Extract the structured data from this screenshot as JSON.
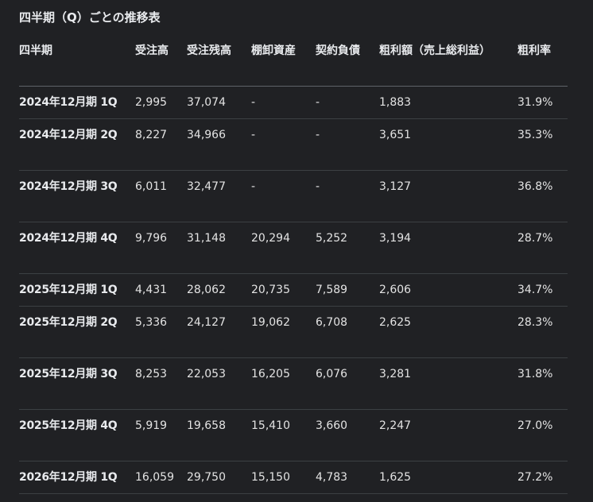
{
  "heading": "四半期（Q）ごとの推移表",
  "table": {
    "headers": [
      "四半期",
      "受注高",
      "受注残高",
      "棚卸資産",
      "契約負債",
      "粗利額（売上総利益）",
      "粗利率"
    ],
    "rows": [
      [
        "2024年12月期 1Q",
        "2,995",
        "37,074",
        "-",
        "-",
        "1,883",
        "31.9%"
      ],
      [
        "2024年12月期 2Q",
        "8,227",
        "34,966",
        "-",
        "-",
        "3,651",
        "35.3%"
      ],
      [
        "2024年12月期 3Q",
        "6,011",
        "32,477",
        "-",
        "-",
        "3,127",
        "36.8%"
      ],
      [
        "2024年12月期 4Q",
        "9,796",
        "31,148",
        "20,294",
        "5,252",
        "3,194",
        "28.7%"
      ],
      [
        "2025年12月期 1Q",
        "4,431",
        "28,062",
        "20,735",
        "7,589",
        "2,606",
        "34.7%"
      ],
      [
        "2025年12月期 2Q",
        "5,336",
        "24,127",
        "19,062",
        "6,708",
        "2,625",
        "28.3%"
      ],
      [
        "2025年12月期 3Q",
        "8,253",
        "22,053",
        "16,205",
        "6,076",
        "3,281",
        "31.8%"
      ],
      [
        "2025年12月期 4Q",
        "5,919",
        "19,658",
        "15,410",
        "3,660",
        "2,247",
        "27.0%"
      ],
      [
        "2026年12月期 1Q",
        "16,059",
        "29,750",
        "15,150",
        "4,783",
        "1,625",
        "27.2%"
      ]
    ]
  }
}
